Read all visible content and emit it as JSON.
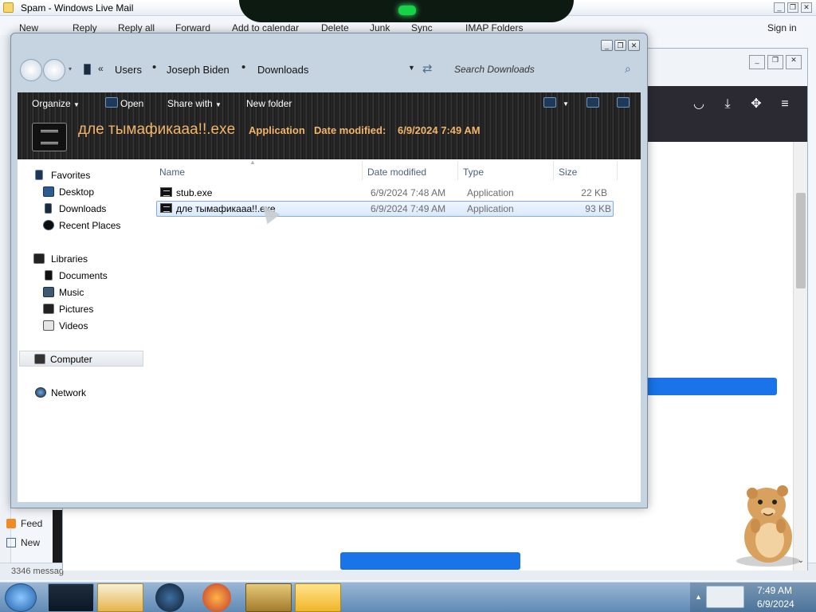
{
  "mail": {
    "title": "Spam - Windows Live Mail",
    "toolbar": [
      "New",
      "Reply",
      "Reply all",
      "Forward",
      "Add to calendar",
      "Delete",
      "Junk",
      "Sync",
      "IMAP Folders"
    ],
    "sign_in": "Sign in",
    "feeds_label": "Feed",
    "new_label": "New",
    "status": "3346 messag"
  },
  "explorer": {
    "breadcrumbs": [
      "Users",
      "Joseph Biden",
      "Downloads"
    ],
    "search_placeholder": "Search Downloads",
    "commands": {
      "organize": "Organize",
      "open": "Open",
      "share_with": "Share with",
      "new_folder": "New folder"
    },
    "details": {
      "filename": "дле тымафикааа!!.exe",
      "type": "Application",
      "date_label": "Date modified:",
      "date_value": "6/9/2024 7:49 AM"
    },
    "navigation": {
      "favorites": {
        "label": "Favorites",
        "items": [
          "Desktop",
          "Downloads",
          "Recent Places"
        ]
      },
      "libraries": {
        "label": "Libraries",
        "items": [
          "Documents",
          "Music",
          "Pictures",
          "Videos"
        ]
      },
      "computer": "Computer",
      "network": "Network"
    },
    "columns": [
      "Name",
      "Date modified",
      "Type",
      "Size"
    ],
    "files": [
      {
        "name": "stub.exe",
        "date": "6/9/2024 7:48 AM",
        "type": "Application",
        "size": "22 KB",
        "selected": false
      },
      {
        "name": "дле тымафикааа!!.exe",
        "date": "6/9/2024 7:49 AM",
        "type": "Application",
        "size": "93 KB",
        "selected": true
      }
    ]
  },
  "taskbar": {
    "time": "7:49 AM",
    "date": "6/9/2024",
    "buttons": [
      "explorer",
      "media-player",
      "globe",
      "firefox",
      "sandboxie",
      "mail"
    ]
  },
  "colors": {
    "details_text": "#f0b56a",
    "selection_border": "#84acdd",
    "firefox_accent": "#1a73e8"
  }
}
